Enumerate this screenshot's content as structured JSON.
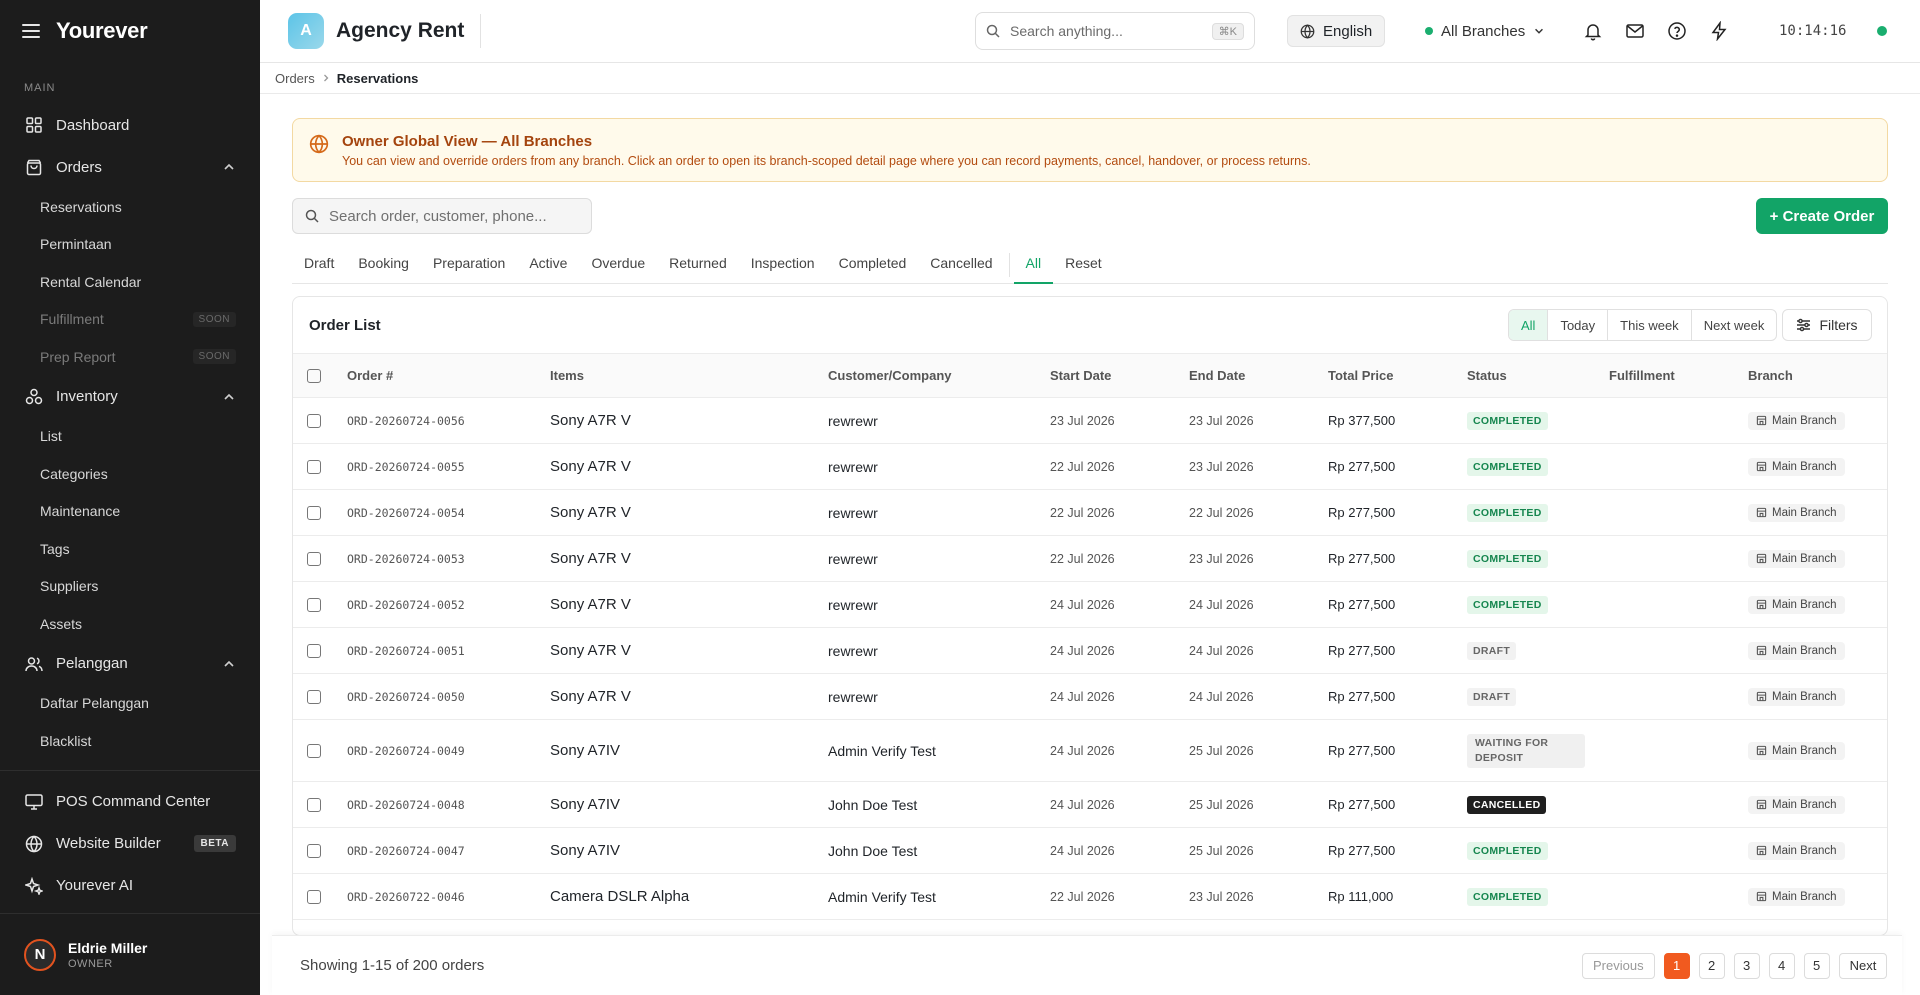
{
  "app": {
    "brand": "Yourever"
  },
  "sidebar": {
    "section_label": "MAIN",
    "dashboard": "Dashboard",
    "orders": "Orders",
    "orders_items": [
      {
        "label": "Reservations",
        "soon": ""
      },
      {
        "label": "Permintaan",
        "soon": ""
      },
      {
        "label": "Rental Calendar",
        "soon": ""
      },
      {
        "label": "Fulfillment",
        "soon": "SOON"
      },
      {
        "label": "Prep Report",
        "soon": "SOON"
      }
    ],
    "inventory": "Inventory",
    "inventory_items": [
      "List",
      "Categories",
      "Maintenance",
      "Tags",
      "Suppliers",
      "Assets"
    ],
    "pelanggan": "Pelanggan",
    "pelanggan_items": [
      "Daftar Pelanggan",
      "Blacklist"
    ],
    "pos": "POS Command Center",
    "website": "Website Builder",
    "website_badge": "BETA",
    "ai": "Yourever AI",
    "user": {
      "initial": "N",
      "name": "Eldrie Miller",
      "role": "OWNER"
    }
  },
  "topbar": {
    "logo_letter": "A",
    "agency": "Agency Rent",
    "search_placeholder": "Search anything...",
    "search_shortcut": "⌘K",
    "language": "English",
    "branch": "All Branches",
    "clock": "10:14:16"
  },
  "breadcrumb": {
    "parent": "Orders",
    "current": "Reservations"
  },
  "banner": {
    "title": "Owner Global View — All Branches",
    "desc": "You can view and override orders from any branch. Click an order to open its branch-scoped detail page where you can record payments, cancel, handover, or process returns."
  },
  "order_search_placeholder": "Search order, customer, phone...",
  "create_label": "+ Create Order",
  "tabs": [
    "Draft",
    "Booking",
    "Preparation",
    "Active",
    "Overdue",
    "Returned",
    "Inspection",
    "Completed",
    "Cancelled"
  ],
  "tab_all": "All",
  "tab_reset": "Reset",
  "list": {
    "title": "Order List",
    "ranges": [
      "All",
      "Today",
      "This week",
      "Next week"
    ],
    "filters": "Filters",
    "columns": [
      "Order #",
      "Items",
      "Customer/Company",
      "Start Date",
      "End Date",
      "Total Price",
      "Status",
      "Fulfillment",
      "Branch"
    ],
    "rows": [
      {
        "no": "ORD-20260724-0056",
        "item": "Sony A7R V",
        "cust": "rewrewr",
        "start": "23 Jul 2026",
        "end": "23 Jul 2026",
        "price": "Rp 377,500",
        "status": "COMPLETED",
        "kind": "completed",
        "branch": "Main Branch"
      },
      {
        "no": "ORD-20260724-0055",
        "item": "Sony A7R V",
        "cust": "rewrewr",
        "start": "22 Jul 2026",
        "end": "23 Jul 2026",
        "price": "Rp 277,500",
        "status": "COMPLETED",
        "kind": "completed",
        "branch": "Main Branch"
      },
      {
        "no": "ORD-20260724-0054",
        "item": "Sony A7R V",
        "cust": "rewrewr",
        "start": "22 Jul 2026",
        "end": "22 Jul 2026",
        "price": "Rp 277,500",
        "status": "COMPLETED",
        "kind": "completed",
        "branch": "Main Branch"
      },
      {
        "no": "ORD-20260724-0053",
        "item": "Sony A7R V",
        "cust": "rewrewr",
        "start": "22 Jul 2026",
        "end": "23 Jul 2026",
        "price": "Rp 277,500",
        "status": "COMPLETED",
        "kind": "completed",
        "branch": "Main Branch"
      },
      {
        "no": "ORD-20260724-0052",
        "item": "Sony A7R V",
        "cust": "rewrewr",
        "start": "24 Jul 2026",
        "end": "24 Jul 2026",
        "price": "Rp 277,500",
        "status": "COMPLETED",
        "kind": "completed",
        "branch": "Main Branch"
      },
      {
        "no": "ORD-20260724-0051",
        "item": "Sony A7R V",
        "cust": "rewrewr",
        "start": "24 Jul 2026",
        "end": "24 Jul 2026",
        "price": "Rp 277,500",
        "status": "DRAFT",
        "kind": "draft",
        "branch": "Main Branch"
      },
      {
        "no": "ORD-20260724-0050",
        "item": "Sony A7R V",
        "cust": "rewrewr",
        "start": "24 Jul 2026",
        "end": "24 Jul 2026",
        "price": "Rp 277,500",
        "status": "DRAFT",
        "kind": "draft",
        "branch": "Main Branch"
      },
      {
        "no": "ORD-20260724-0049",
        "item": "Sony A7IV",
        "cust": "Admin Verify Test",
        "start": "24 Jul 2026",
        "end": "25 Jul 2026",
        "price": "Rp 277,500",
        "status": "WAITING FOR DEPOSIT",
        "kind": "waiting",
        "branch": "Main Branch"
      },
      {
        "no": "ORD-20260724-0048",
        "item": "Sony A7IV",
        "cust": "John Doe Test",
        "start": "24 Jul 2026",
        "end": "25 Jul 2026",
        "price": "Rp 277,500",
        "status": "CANCELLED",
        "kind": "cancelled",
        "branch": "Main Branch"
      },
      {
        "no": "ORD-20260724-0047",
        "item": "Sony A7IV",
        "cust": "John Doe Test",
        "start": "24 Jul 2026",
        "end": "25 Jul 2026",
        "price": "Rp 277,500",
        "status": "COMPLETED",
        "kind": "completed",
        "branch": "Main Branch"
      },
      {
        "no": "ORD-20260722-0046",
        "item": "Camera DSLR Alpha",
        "cust": "Admin Verify Test",
        "start": "22 Jul 2026",
        "end": "23 Jul 2026",
        "price": "Rp 111,000",
        "status": "COMPLETED",
        "kind": "completed",
        "branch": "Main Branch"
      }
    ]
  },
  "pagination": {
    "showing": "Showing 1-15 of 200 orders",
    "previous": "Previous",
    "pages": [
      "1",
      "2",
      "3",
      "4",
      "5"
    ],
    "current_page": "1",
    "next": "Next"
  },
  "colors": {
    "accent": "#12a467",
    "warning": "#a4440e",
    "page_current": "#f15a1f",
    "sidebar_bg": "#1c1c1c"
  }
}
